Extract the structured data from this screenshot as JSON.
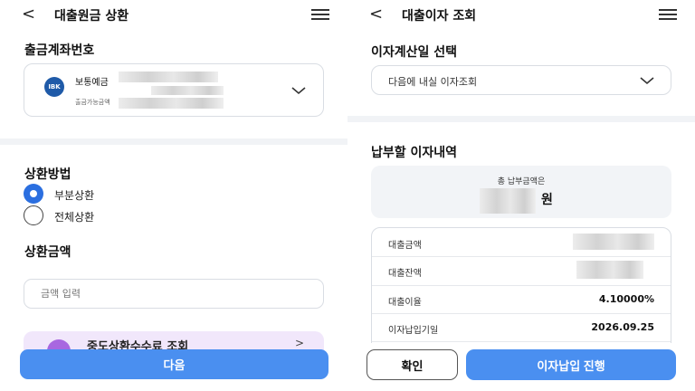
{
  "left": {
    "header": {
      "back_icon": "<",
      "title": "대출원금 상환"
    },
    "account": {
      "section_title": "출금계좌번호",
      "bank_logo_text": "IBK",
      "account_type": "보통예금",
      "available_label": "출금가능금액"
    },
    "method": {
      "section_title": "상환방법",
      "options": [
        {
          "label": "부분상환",
          "selected": true
        },
        {
          "label": "전체상환",
          "selected": false
        }
      ]
    },
    "amount": {
      "section_title": "상환금액",
      "placeholder": "금액 입력"
    },
    "promo": {
      "text": "중도상환수수료 조회",
      "arrow": ">"
    },
    "next_button": "다음"
  },
  "right": {
    "header": {
      "back_icon": "<",
      "title": "대출이자 조회"
    },
    "date_select": {
      "section_title": "이자계산일 선택",
      "selected": "다음에 내실 이자조회"
    },
    "payment": {
      "section_title": "납부할 이자내역",
      "total_label": "총 납부금액은",
      "total_unit": "원",
      "rows": [
        {
          "label": "대출금액",
          "value": ""
        },
        {
          "label": "대출잔액",
          "value": ""
        },
        {
          "label": "대출이율",
          "value": "4.10000%"
        },
        {
          "label": "이자납입기일",
          "value": "2026.09.25"
        }
      ]
    },
    "confirm_button": "확인",
    "proceed_button": "이자납입 진행"
  },
  "colors": {
    "primary": "#4a8ff0",
    "radio": "#2b6fe0",
    "separator": "#f1f3f6",
    "promo_bg": "#f1e7fb"
  }
}
